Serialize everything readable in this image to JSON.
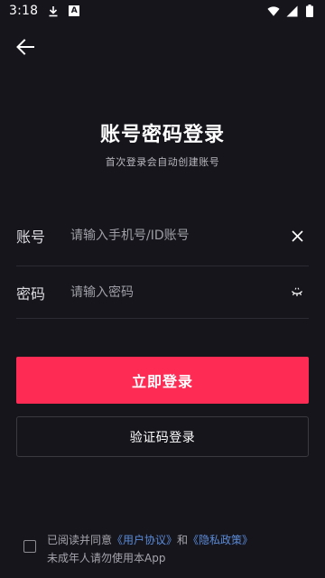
{
  "status_bar": {
    "time": "3:18",
    "notif_a": "A"
  },
  "header": {
    "title": "账号密码登录",
    "subtitle": "首次登录会自动创建账号"
  },
  "form": {
    "account_label": "账号",
    "account_placeholder": "请输入手机号/ID账号",
    "password_label": "密码",
    "password_placeholder": "请输入密码"
  },
  "buttons": {
    "login": "立即登录",
    "sms_login": "验证码登录"
  },
  "agreement": {
    "prefix": "已阅读并同意",
    "user_agreement": "《用户协议》",
    "and": "和",
    "privacy_policy": "《隐私政策》",
    "minor_notice": "未成年人请勿使用本App"
  },
  "colors": {
    "background": "#16151c",
    "primary": "#fe2c55",
    "link": "#5b8bd8"
  }
}
